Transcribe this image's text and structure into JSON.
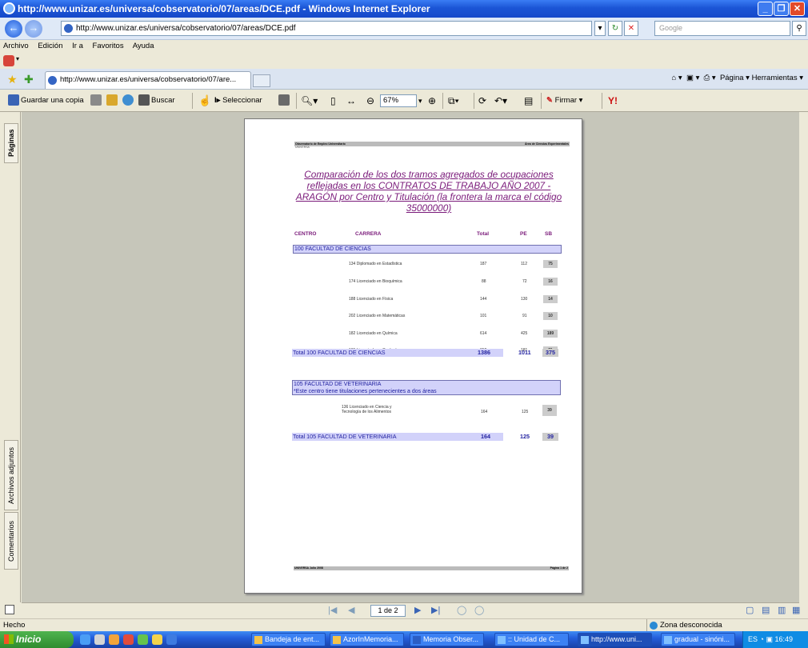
{
  "window": {
    "title": "http://www.unizar.es/universa/cobservatorio/07/areas/DCE.pdf - Windows Internet Explorer",
    "url": "http://www.unizar.es/universa/cobservatorio/07/areas/DCE.pdf",
    "search_placeholder": "Google"
  },
  "menu": [
    "Archivo",
    "Edición",
    "Ir a",
    "Favoritos",
    "Ayuda"
  ],
  "tab": {
    "title": "http://www.unizar.es/universa/cobservatorio/07/are...",
    "tools": "Página ▾  Herramientas ▾"
  },
  "pdf_toolbar": {
    "save_copy": "Guardar una copia",
    "search": "Buscar",
    "select": "Seleccionar",
    "zoom": "67%",
    "sign": "Firmar ▾"
  },
  "side_tabs": {
    "pages": "Páginas",
    "attachments": "Archivos adjuntos",
    "comments": "Comentarios"
  },
  "pdf": {
    "header_left": "Observatorio de Empleo Universitario",
    "header_left2": "UNIVERSA",
    "header_right": "Área de Ciencias Experimentales",
    "title": "Comparación de los dos tramos agregados de ocupaciones reflejadas en los CONTRATOS DE TRABAJO AÑO 2007 - ARAGÓN por Centro y Titulación (la frontera la marca el código 35000000)",
    "columns": {
      "centro": "CENTRO",
      "carrera": "CARRERA",
      "total": "Total",
      "pe": "PE",
      "sb": "SB"
    },
    "faculty1": {
      "name": "100 FACULTAD DE CIENCIAS",
      "rows": [
        {
          "carrera": "134 Diplomado en Estadística",
          "total": "187",
          "pe": "112",
          "sb": "75"
        },
        {
          "carrera": "174 Licenciado en Bioquímica",
          "total": "88",
          "pe": "72",
          "sb": "16"
        },
        {
          "carrera": "188 Licenciado en Física",
          "total": "144",
          "pe": "130",
          "sb": "14"
        },
        {
          "carrera": "202 Licenciado en Matemáticas",
          "total": "101",
          "pe": "91",
          "sb": "10"
        },
        {
          "carrera": "182 Licenciado en Química",
          "total": "614",
          "pe": "425",
          "sb": "189"
        },
        {
          "carrera": "195 Licenciado en Geología",
          "total": "252",
          "pe": "181",
          "sb": "71"
        }
      ],
      "total": {
        "label": "Total 100 FACULTAD DE CIENCIAS",
        "total": "1386",
        "pe": "1011",
        "sb": "375"
      }
    },
    "faculty2": {
      "name": "105 FACULTAD DE VETERINARIA",
      "note": "*Este centro tiene titulaciones pertenecientes a dos áreas",
      "row": {
        "carrera1": "136 Licenciado en Ciencia y",
        "carrera2": "Tecnología de los Alimentos",
        "total": "164",
        "pe": "125",
        "sb": "39"
      },
      "total": {
        "label": "Total 105 FACULTAD DE VETERINARIA",
        "total": "164",
        "pe": "125",
        "sb": "39"
      }
    },
    "footer_left": "UNIVERSA Julio 2008",
    "footer_right": "Página 1 de 2"
  },
  "page_nav": {
    "page": "1 de 2"
  },
  "status": {
    "left": "Hecho",
    "zone": "Zona desconocida"
  },
  "taskbar": {
    "start": "Inicio",
    "tasks": [
      "Bandeja de ent...",
      "AzorInMemoria...",
      "Memoria Obser...",
      ":: Unidad de C...",
      "http://www.uni...",
      "gradual - sinóni..."
    ],
    "lang": "ES",
    "time": "16:49"
  }
}
